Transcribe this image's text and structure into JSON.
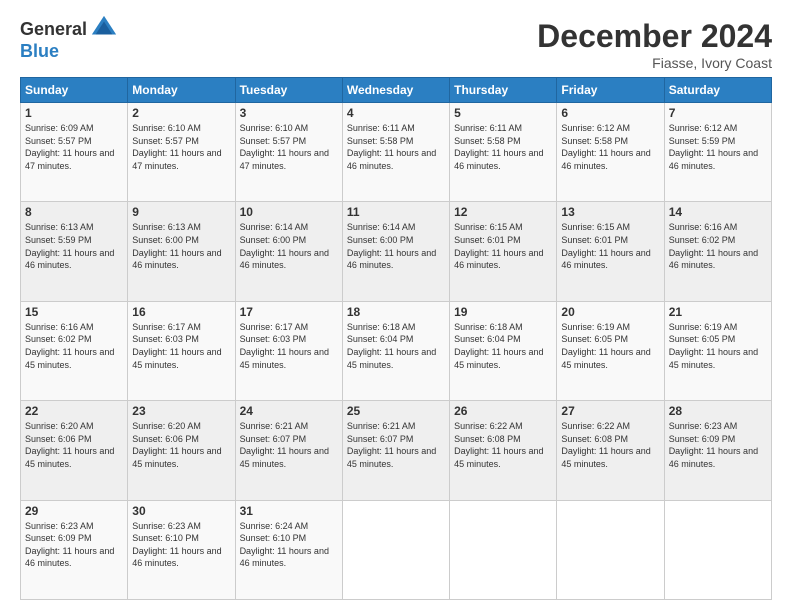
{
  "header": {
    "logo_general": "General",
    "logo_blue": "Blue",
    "month_title": "December 2024",
    "location": "Fiasse, Ivory Coast"
  },
  "calendar": {
    "days_of_week": [
      "Sunday",
      "Monday",
      "Tuesday",
      "Wednesday",
      "Thursday",
      "Friday",
      "Saturday"
    ],
    "weeks": [
      [
        {
          "day": "",
          "empty": true
        },
        {
          "day": "",
          "empty": true
        },
        {
          "day": "",
          "empty": true
        },
        {
          "day": "",
          "empty": true
        },
        {
          "day": "",
          "empty": true
        },
        {
          "day": "",
          "empty": true
        },
        {
          "day": "",
          "empty": true
        }
      ],
      [
        {
          "day": "1",
          "rise": "6:09 AM",
          "set": "5:57 PM",
          "daylight": "11 hours and 47 minutes."
        },
        {
          "day": "2",
          "rise": "6:10 AM",
          "set": "5:57 PM",
          "daylight": "11 hours and 47 minutes."
        },
        {
          "day": "3",
          "rise": "6:10 AM",
          "set": "5:57 PM",
          "daylight": "11 hours and 47 minutes."
        },
        {
          "day": "4",
          "rise": "6:11 AM",
          "set": "5:58 PM",
          "daylight": "11 hours and 46 minutes."
        },
        {
          "day": "5",
          "rise": "6:11 AM",
          "set": "5:58 PM",
          "daylight": "11 hours and 46 minutes."
        },
        {
          "day": "6",
          "rise": "6:12 AM",
          "set": "5:58 PM",
          "daylight": "11 hours and 46 minutes."
        },
        {
          "day": "7",
          "rise": "6:12 AM",
          "set": "5:59 PM",
          "daylight": "11 hours and 46 minutes."
        }
      ],
      [
        {
          "day": "8",
          "rise": "6:13 AM",
          "set": "5:59 PM",
          "daylight": "11 hours and 46 minutes."
        },
        {
          "day": "9",
          "rise": "6:13 AM",
          "set": "6:00 PM",
          "daylight": "11 hours and 46 minutes."
        },
        {
          "day": "10",
          "rise": "6:14 AM",
          "set": "6:00 PM",
          "daylight": "11 hours and 46 minutes."
        },
        {
          "day": "11",
          "rise": "6:14 AM",
          "set": "6:00 PM",
          "daylight": "11 hours and 46 minutes."
        },
        {
          "day": "12",
          "rise": "6:15 AM",
          "set": "6:01 PM",
          "daylight": "11 hours and 46 minutes."
        },
        {
          "day": "13",
          "rise": "6:15 AM",
          "set": "6:01 PM",
          "daylight": "11 hours and 46 minutes."
        },
        {
          "day": "14",
          "rise": "6:16 AM",
          "set": "6:02 PM",
          "daylight": "11 hours and 46 minutes."
        }
      ],
      [
        {
          "day": "15",
          "rise": "6:16 AM",
          "set": "6:02 PM",
          "daylight": "11 hours and 45 minutes."
        },
        {
          "day": "16",
          "rise": "6:17 AM",
          "set": "6:03 PM",
          "daylight": "11 hours and 45 minutes."
        },
        {
          "day": "17",
          "rise": "6:17 AM",
          "set": "6:03 PM",
          "daylight": "11 hours and 45 minutes."
        },
        {
          "day": "18",
          "rise": "6:18 AM",
          "set": "6:04 PM",
          "daylight": "11 hours and 45 minutes."
        },
        {
          "day": "19",
          "rise": "6:18 AM",
          "set": "6:04 PM",
          "daylight": "11 hours and 45 minutes."
        },
        {
          "day": "20",
          "rise": "6:19 AM",
          "set": "6:05 PM",
          "daylight": "11 hours and 45 minutes."
        },
        {
          "day": "21",
          "rise": "6:19 AM",
          "set": "6:05 PM",
          "daylight": "11 hours and 45 minutes."
        }
      ],
      [
        {
          "day": "22",
          "rise": "6:20 AM",
          "set": "6:06 PM",
          "daylight": "11 hours and 45 minutes."
        },
        {
          "day": "23",
          "rise": "6:20 AM",
          "set": "6:06 PM",
          "daylight": "11 hours and 45 minutes."
        },
        {
          "day": "24",
          "rise": "6:21 AM",
          "set": "6:07 PM",
          "daylight": "11 hours and 45 minutes."
        },
        {
          "day": "25",
          "rise": "6:21 AM",
          "set": "6:07 PM",
          "daylight": "11 hours and 45 minutes."
        },
        {
          "day": "26",
          "rise": "6:22 AM",
          "set": "6:08 PM",
          "daylight": "11 hours and 45 minutes."
        },
        {
          "day": "27",
          "rise": "6:22 AM",
          "set": "6:08 PM",
          "daylight": "11 hours and 45 minutes."
        },
        {
          "day": "28",
          "rise": "6:23 AM",
          "set": "6:09 PM",
          "daylight": "11 hours and 46 minutes."
        }
      ],
      [
        {
          "day": "29",
          "rise": "6:23 AM",
          "set": "6:09 PM",
          "daylight": "11 hours and 46 minutes."
        },
        {
          "day": "30",
          "rise": "6:23 AM",
          "set": "6:10 PM",
          "daylight": "11 hours and 46 minutes."
        },
        {
          "day": "31",
          "rise": "6:24 AM",
          "set": "6:10 PM",
          "daylight": "11 hours and 46 minutes."
        },
        {
          "day": "",
          "empty": true
        },
        {
          "day": "",
          "empty": true
        },
        {
          "day": "",
          "empty": true
        },
        {
          "day": "",
          "empty": true
        }
      ]
    ]
  }
}
